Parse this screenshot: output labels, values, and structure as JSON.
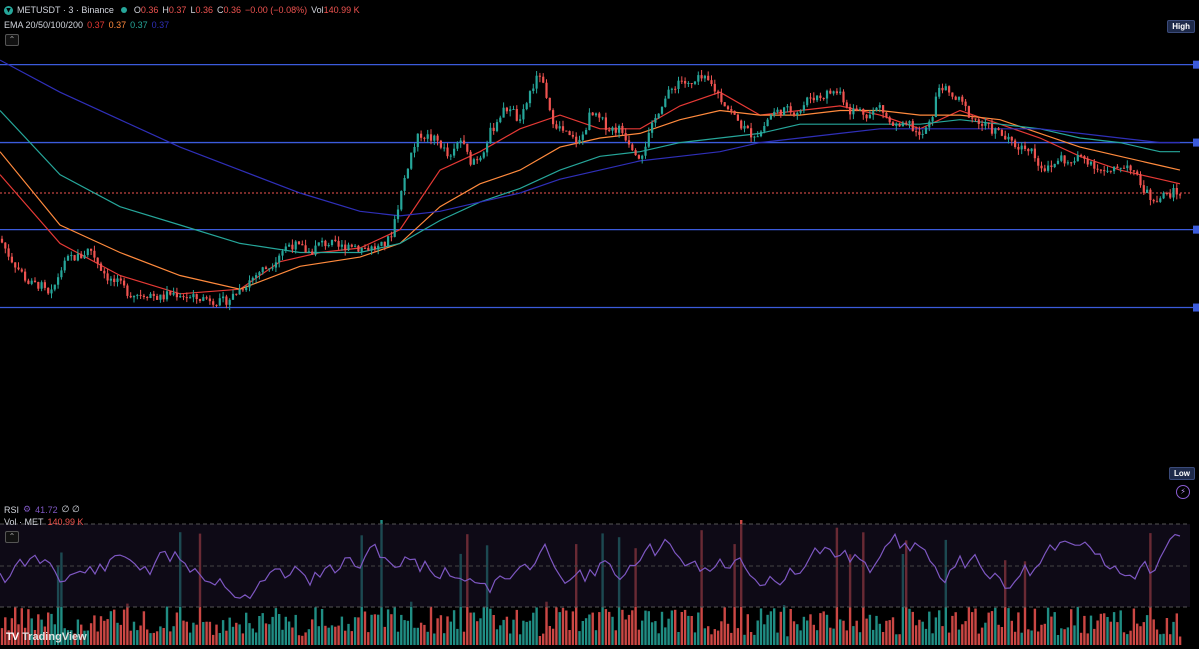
{
  "symbol": {
    "title": "METUSDT · 3 · Binance",
    "ohlc": [
      {
        "key": "O",
        "value": "0.36"
      },
      {
        "key": "H",
        "value": "0.37"
      },
      {
        "key": "L",
        "value": "0.36"
      },
      {
        "key": "C",
        "value": "0.36"
      },
      {
        "key": "chg",
        "value": "−0.00 (−0.08%)"
      }
    ],
    "vol_label": "Vol",
    "vol_value": "140.99 K"
  },
  "ema_legend": {
    "label": "EMA 20/50/100/200",
    "values": [
      "0.37",
      "0.37",
      "0.37",
      "0.37"
    ]
  },
  "rsi_legend": {
    "label": "RSI",
    "value": "41.72",
    "extra": "∅ ∅"
  },
  "vol_legend": {
    "label": "Vol · MET",
    "value": "140.99 K"
  },
  "tags": {
    "high": "High",
    "low": "Low"
  },
  "brand": {
    "name": "TradingView",
    "logo": "TV"
  },
  "colors": {
    "up": "#26a69a",
    "down": "#ef5350",
    "ema20": "#e53935",
    "ema50": "#ff8a3d",
    "ema100": "#26a69a",
    "ema200": "#2f2fb8",
    "hline": "#3b5bdb",
    "rsi": "#7e57c2"
  },
  "chart_data": {
    "type": "line",
    "title": "METUSDT · 3 · Binance",
    "ylim": [
      0.316,
      0.419
    ],
    "horizontal_levels": [
      0.411,
      0.394,
      0.375,
      0.358
    ],
    "current_price_level": 0.383,
    "series": [
      {
        "name": "price",
        "x": [
          0,
          10,
          20,
          30,
          40,
          50,
          60,
          70,
          80,
          90,
          100,
          110,
          120,
          130,
          140,
          150,
          160,
          170,
          180,
          190,
          200,
          210,
          220,
          230,
          240,
          250,
          260,
          270,
          280,
          290,
          300,
          310,
          320,
          330,
          340,
          350,
          360,
          370,
          380,
          390,
          400,
          410,
          420,
          430,
          440,
          450,
          460,
          470,
          480,
          490,
          500,
          510,
          520,
          530,
          540,
          550,
          560,
          570,
          580,
          590,
          600,
          610,
          620,
          630,
          640,
          650,
          660,
          670,
          680,
          690,
          700,
          710,
          720,
          730,
          740,
          750,
          760,
          770,
          780,
          790,
          800,
          810,
          820,
          830,
          840,
          850,
          860,
          870,
          880,
          890,
          900,
          910,
          920,
          930,
          940,
          950,
          960,
          970,
          980,
          990,
          1000,
          1010,
          1020,
          1030,
          1040,
          1050,
          1060,
          1070,
          1080,
          1090,
          1100,
          1110,
          1120,
          1130,
          1140,
          1150,
          1160,
          1170,
          1180
        ],
        "values": [
          0.373,
          0.369,
          0.366,
          0.363,
          0.363,
          0.36,
          0.366,
          0.369,
          0.369,
          0.371,
          0.367,
          0.364,
          0.363,
          0.361,
          0.361,
          0.361,
          0.36,
          0.361,
          0.361,
          0.36,
          0.36,
          0.36,
          0.359,
          0.36,
          0.362,
          0.364,
          0.366,
          0.367,
          0.37,
          0.372,
          0.371,
          0.37,
          0.372,
          0.372,
          0.371,
          0.372,
          0.371,
          0.371,
          0.371,
          0.373,
          0.382,
          0.391,
          0.396,
          0.395,
          0.394,
          0.39,
          0.395,
          0.39,
          0.391,
          0.396,
          0.4,
          0.402,
          0.398,
          0.405,
          0.409,
          0.4,
          0.397,
          0.395,
          0.394,
          0.4,
          0.399,
          0.397,
          0.397,
          0.394,
          0.391,
          0.396,
          0.402,
          0.405,
          0.408,
          0.406,
          0.408,
          0.407,
          0.404,
          0.401,
          0.398,
          0.396,
          0.396,
          0.4,
          0.401,
          0.401,
          0.401,
          0.404,
          0.404,
          0.405,
          0.405,
          0.401,
          0.401,
          0.4,
          0.402,
          0.398,
          0.397,
          0.398,
          0.395,
          0.398,
          0.407,
          0.404,
          0.403,
          0.4,
          0.398,
          0.397,
          0.396,
          0.394,
          0.393,
          0.393,
          0.389,
          0.388,
          0.391,
          0.389,
          0.391,
          0.39,
          0.388,
          0.387,
          0.389,
          0.389,
          0.385,
          0.382,
          0.382,
          0.383,
          0.383
        ]
      },
      {
        "name": "EMA 20",
        "x": [
          0,
          60,
          120,
          180,
          240,
          280,
          320,
          360,
          400,
          440,
          480,
          520,
          560,
          600,
          640,
          680,
          720,
          760,
          800,
          840,
          880,
          920,
          960,
          1000,
          1040,
          1080,
          1120,
          1160,
          1180
        ],
        "values": [
          0.387,
          0.372,
          0.365,
          0.361,
          0.362,
          0.368,
          0.37,
          0.371,
          0.375,
          0.388,
          0.392,
          0.397,
          0.4,
          0.397,
          0.397,
          0.402,
          0.405,
          0.4,
          0.401,
          0.402,
          0.4,
          0.397,
          0.401,
          0.398,
          0.395,
          0.391,
          0.388,
          0.386,
          0.385
        ]
      },
      {
        "name": "EMA 50",
        "x": [
          0,
          60,
          120,
          180,
          240,
          300,
          360,
          400,
          440,
          480,
          520,
          560,
          600,
          640,
          680,
          720,
          760,
          800,
          840,
          880,
          920,
          960,
          1000,
          1040,
          1080,
          1120,
          1160,
          1180
        ],
        "values": [
          0.392,
          0.376,
          0.37,
          0.365,
          0.362,
          0.367,
          0.369,
          0.372,
          0.38,
          0.385,
          0.388,
          0.393,
          0.395,
          0.396,
          0.399,
          0.401,
          0.4,
          0.4,
          0.401,
          0.401,
          0.4,
          0.4,
          0.399,
          0.396,
          0.393,
          0.391,
          0.389,
          0.388
        ]
      },
      {
        "name": "EMA 100",
        "x": [
          0,
          60,
          120,
          180,
          240,
          300,
          360,
          400,
          440,
          480,
          520,
          560,
          600,
          640,
          680,
          720,
          760,
          800,
          840,
          880,
          920,
          960,
          1000,
          1040,
          1080,
          1120,
          1160,
          1180
        ],
        "values": [
          0.401,
          0.387,
          0.38,
          0.376,
          0.372,
          0.37,
          0.37,
          0.372,
          0.377,
          0.381,
          0.384,
          0.388,
          0.391,
          0.392,
          0.394,
          0.395,
          0.396,
          0.398,
          0.398,
          0.398,
          0.398,
          0.399,
          0.398,
          0.397,
          0.395,
          0.394,
          0.392,
          0.392
        ]
      },
      {
        "name": "EMA 200",
        "x": [
          0,
          60,
          120,
          180,
          240,
          300,
          360,
          400,
          440,
          480,
          520,
          560,
          600,
          640,
          680,
          720,
          760,
          800,
          840,
          880,
          920,
          960,
          1000,
          1040,
          1080,
          1120,
          1160,
          1180
        ],
        "values": [
          0.412,
          0.405,
          0.399,
          0.393,
          0.388,
          0.383,
          0.379,
          0.378,
          0.379,
          0.381,
          0.383,
          0.386,
          0.388,
          0.39,
          0.391,
          0.392,
          0.394,
          0.395,
          0.396,
          0.397,
          0.397,
          0.397,
          0.397,
          0.397,
          0.396,
          0.395,
          0.394,
          0.394
        ]
      }
    ]
  }
}
